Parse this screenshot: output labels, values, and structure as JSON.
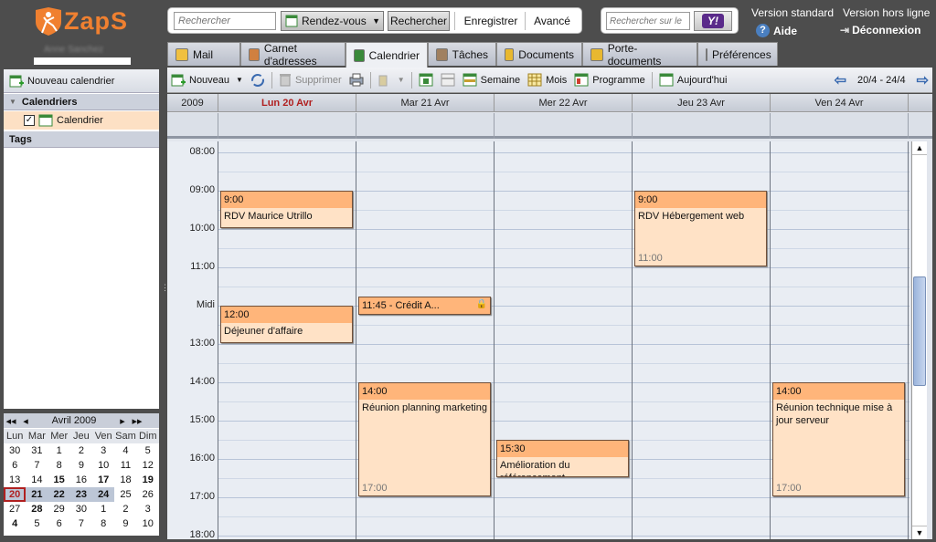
{
  "app": {
    "logo_text": "ZapS"
  },
  "search": {
    "placeholder": "Rechercher",
    "type_value": "Rendez-vous",
    "search_button": "Rechercher",
    "save_button": "Enregistrer",
    "advanced_button": "Avancé",
    "web_placeholder": "Rechercher sur le",
    "web_engine": "Y!"
  },
  "top_links": {
    "standard": "Version standard",
    "offline": "Version hors ligne",
    "help": "Aide",
    "logout": "Déconnexion"
  },
  "user": {
    "name": "Anne Sanchez"
  },
  "tabs": [
    {
      "label": "Mail",
      "icon": "mail-icon",
      "color": "#f0c040"
    },
    {
      "label": "Carnet d'adresses",
      "icon": "contacts-icon",
      "color": "#d08040"
    },
    {
      "label": "Calendrier",
      "icon": "calendar-icon",
      "color": "#3a8a3a"
    },
    {
      "label": "Tâches",
      "icon": "tasks-icon",
      "color": "#a08060"
    },
    {
      "label": "Documents",
      "icon": "documents-icon",
      "color": "#e8b830"
    },
    {
      "label": "Porte-documents",
      "icon": "briefcase-icon",
      "color": "#e8b830"
    },
    {
      "label": "Préférences",
      "icon": "preferences-icon",
      "color": "#888888"
    }
  ],
  "toolbar": {
    "new": "Nouveau",
    "delete": "Supprimer",
    "week": "Semaine",
    "month": "Mois",
    "schedule": "Programme",
    "today": "Aujourd'hui",
    "range": "20/4 - 24/4"
  },
  "sidebar": {
    "new_calendar": "Nouveau calendrier",
    "calendars_header": "Calendriers",
    "calendar_item": "Calendrier",
    "tags_header": "Tags"
  },
  "minical": {
    "title": "Avril 2009",
    "days": [
      "Lun",
      "Mar",
      "Mer",
      "Jeu",
      "Ven",
      "Sam",
      "Dim"
    ],
    "weeks": [
      [
        "30",
        "31",
        "1",
        "2",
        "3",
        "4",
        "5"
      ],
      [
        "6",
        "7",
        "8",
        "9",
        "10",
        "11",
        "12"
      ],
      [
        "13",
        "14",
        "15",
        "16",
        "17",
        "18",
        "19"
      ],
      [
        "20",
        "21",
        "22",
        "23",
        "24",
        "25",
        "26"
      ],
      [
        "27",
        "28",
        "29",
        "30",
        "1",
        "2",
        "3"
      ],
      [
        "4",
        "5",
        "6",
        "7",
        "8",
        "9",
        "10"
      ]
    ]
  },
  "calendar": {
    "year": "2009",
    "days": [
      {
        "label": "Lun 20 Avr",
        "today": true
      },
      {
        "label": "Mar 21 Avr",
        "today": false
      },
      {
        "label": "Mer 22 Avr",
        "today": false
      },
      {
        "label": "Jeu 23 Avr",
        "today": false
      },
      {
        "label": "Ven 24 Avr",
        "today": false
      }
    ],
    "hours": [
      "08:00",
      "09:00",
      "10:00",
      "11:00",
      "Midi",
      "13:00",
      "14:00",
      "15:00",
      "16:00",
      "17:00",
      "18:00"
    ],
    "appointments": [
      {
        "start": "9:00",
        "title": "RDV Maurice Utrillo",
        "end": ""
      },
      {
        "start": "12:00",
        "title": "Déjeuner d'affaire",
        "end": ""
      },
      {
        "start": "11:45 - Crédit A...",
        "title": "",
        "end": ""
      },
      {
        "start": "14:00",
        "title": "Réunion planning marketing",
        "end": "17:00"
      },
      {
        "start": "15:30",
        "title": "Amélioration du référencement",
        "end": ""
      },
      {
        "start": "9:00",
        "title": "RDV Hébergement web",
        "end": "11:00"
      },
      {
        "start": "14:00",
        "title": "Réunion technique mise à jour serveur",
        "end": "17:00"
      }
    ]
  },
  "colors": {
    "accent": "#f08030",
    "today": "#b02020",
    "appointment_header": "#ffb57a",
    "appointment_body": "#ffe2c6"
  }
}
